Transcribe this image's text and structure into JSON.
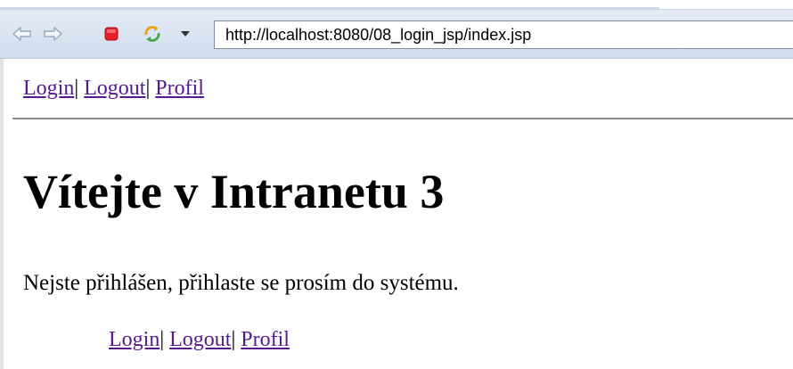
{
  "browser": {
    "address_url": "http://localhost:8080/08_login_jsp/index.jsp",
    "icons": {
      "back": "back-arrow-icon",
      "forward": "forward-arrow-icon",
      "stop": "stop-icon",
      "refresh": "refresh-icon",
      "dropdown": "chevron-down-icon"
    }
  },
  "page": {
    "nav_top": {
      "login": "Login",
      "sep1": "|",
      "logout": "Logout",
      "sep2": "|",
      "profil": "Profil"
    },
    "title": "Vítejte v Intranetu 3",
    "message": "Nejste přihlášen, přihlaste se prosím do systému.",
    "nav_bottom": {
      "login": "Login",
      "sep1": "|",
      "logout": "Logout",
      "sep2": "|",
      "profil": "Profil"
    }
  },
  "colors": {
    "link": "#551a8b",
    "toolbar": "#d9e3f0"
  }
}
